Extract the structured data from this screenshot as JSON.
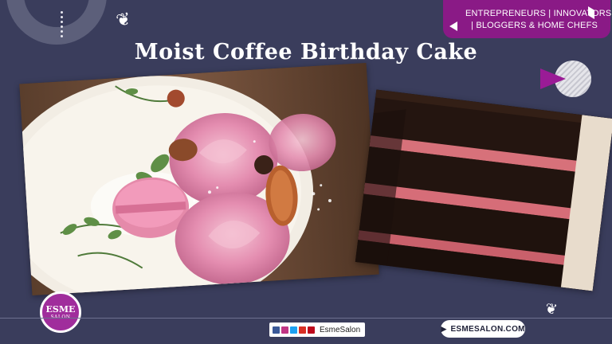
{
  "header": {
    "title": "Moist Coffee Birthday Cake",
    "badge_line1": "ENTREPRENEURS | INNOVATORS",
    "badge_line2": "| BLOGGERS & HOME CHEFS"
  },
  "logo": {
    "top": "ESME",
    "bottom": "SALON"
  },
  "footer": {
    "social_handle": "EsmeSalon",
    "website": "ESMESALON.COM",
    "social_icons": [
      "facebook-icon",
      "instagram-icon",
      "twitter-icon",
      "youtube-icon",
      "pinterest-icon"
    ]
  },
  "colors": {
    "background": "#3a3d5c",
    "accent": "#8a1a86",
    "logo": "#a02d9c"
  }
}
